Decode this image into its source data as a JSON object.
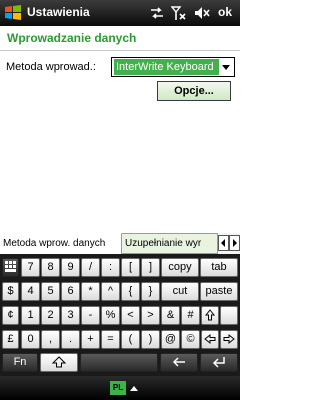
{
  "titlebar": {
    "title": "Ustawienia",
    "ok_label": "ok"
  },
  "page": {
    "heading": "Wprowadzanie danych"
  },
  "form": {
    "method_label": "Metoda wprowad.:",
    "method_value": "InterWrite Keyboard",
    "options_label": "Opcje..."
  },
  "tabs": [
    {
      "label": "Metoda wprow. danych"
    },
    {
      "label": "Uzupełnianie wyr"
    }
  ],
  "keyboard": {
    "rows": [
      [
        {
          "label": "7"
        },
        {
          "label": "8"
        },
        {
          "label": "9"
        },
        {
          "label": "/"
        },
        {
          "label": ":"
        },
        {
          "label": "["
        },
        {
          "label": "]"
        },
        {
          "label": "copy"
        },
        {
          "label": "tab"
        }
      ],
      [
        {
          "label": "$"
        },
        {
          "label": "4"
        },
        {
          "label": "5"
        },
        {
          "label": "6"
        },
        {
          "label": "*"
        },
        {
          "label": "^"
        },
        {
          "label": "{"
        },
        {
          "label": "}"
        },
        {
          "label": "cut"
        },
        {
          "label": "paste"
        }
      ],
      [
        {
          "label": "¢"
        },
        {
          "label": "1"
        },
        {
          "label": "2"
        },
        {
          "label": "3"
        },
        {
          "label": "-"
        },
        {
          "label": "%"
        },
        {
          "label": "<"
        },
        {
          "label": ">"
        },
        {
          "label": "&"
        },
        {
          "label": "#"
        }
      ],
      [
        {
          "label": "£"
        },
        {
          "label": "0"
        },
        {
          "label": ","
        },
        {
          "label": "."
        },
        {
          "label": "+"
        },
        {
          "label": "="
        },
        {
          "label": "("
        },
        {
          "label": ")"
        },
        {
          "label": "@"
        },
        {
          "label": "©"
        }
      ]
    ],
    "fn_label": "Fn"
  },
  "sip": {
    "language": "PL"
  }
}
